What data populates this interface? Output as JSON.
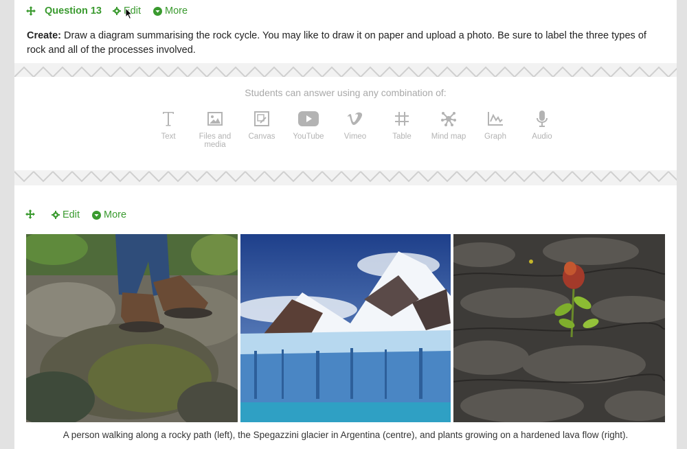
{
  "question": {
    "title": "Question 13",
    "edit_label": "Edit",
    "more_label": "More",
    "prompt_bold": "Create:",
    "prompt_text": " Draw a diagram summarising the rock cycle. You may like to draw it on paper and upload a photo. Be sure to label the three types of rock and all of the processes involved."
  },
  "answer_options": {
    "heading": "Students can answer using any combination of:",
    "items": [
      {
        "label": "Text",
        "icon": "text-icon"
      },
      {
        "label": "Files and media",
        "icon": "image-icon"
      },
      {
        "label": "Canvas",
        "icon": "canvas-icon"
      },
      {
        "label": "YouTube",
        "icon": "youtube-icon"
      },
      {
        "label": "Vimeo",
        "icon": "vimeo-icon"
      },
      {
        "label": "Table",
        "icon": "table-icon"
      },
      {
        "label": "Mind map",
        "icon": "mindmap-icon"
      },
      {
        "label": "Graph",
        "icon": "graph-icon"
      },
      {
        "label": "Audio",
        "icon": "microphone-icon"
      }
    ]
  },
  "media_block": {
    "edit_label": "Edit",
    "more_label": "More",
    "caption": "A person walking along a rocky path (left), the Spegazzini glacier in Argentina (centre), and plants growing on a hardened lava flow (right)."
  },
  "colors": {
    "accent_green": "#3a9a2f",
    "muted_grey": "#b3b3b3"
  }
}
